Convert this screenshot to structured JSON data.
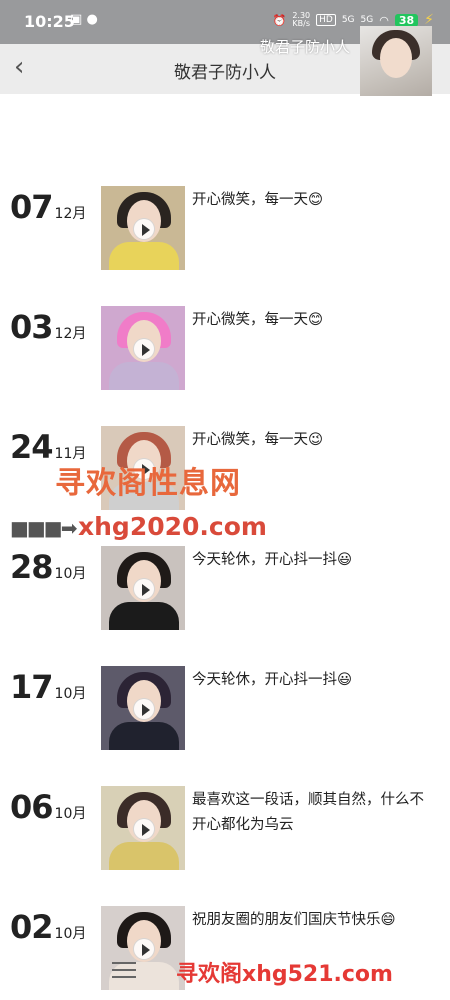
{
  "status_bar": {
    "time": "10:25",
    "left_icons": [
      "notification-icon",
      "wechat-icon"
    ],
    "net_rate": "2.30\nKB/s",
    "hd": "HD",
    "sim1": "5G",
    "sim2": "5G",
    "battery": "38"
  },
  "header": {
    "back_icon": "chevron-left-icon",
    "title": "敬君子防小人"
  },
  "profile": {
    "name": "敬君子防小人"
  },
  "feed": [
    {
      "day": "07",
      "month": "12月",
      "caption": "开心微笑，每一天😊",
      "thumb_colors": {
        "bg": "#c9b895",
        "hair": "#2a2420",
        "body": "#e8d35a"
      }
    },
    {
      "day": "03",
      "month": "12月",
      "caption": "开心微笑，每一天😊",
      "thumb_colors": {
        "bg": "#cfa8cf",
        "hair": "#f07cc8",
        "body": "#c4b2d4"
      }
    },
    {
      "day": "24",
      "month": "11月",
      "caption": "开心微笑，每一天😉",
      "thumb_colors": {
        "bg": "#d9c9b9",
        "hair": "#b45a46",
        "body": "#cfcfcf"
      }
    },
    {
      "day": "28",
      "month": "10月",
      "caption": "今天轮休，开心抖一抖😃",
      "thumb_colors": {
        "bg": "#c9c2be",
        "hair": "#1f1a18",
        "body": "#1b1b1b"
      }
    },
    {
      "day": "17",
      "month": "10月",
      "caption": "今天轮休，开心抖一抖😃",
      "thumb_colors": {
        "bg": "#5d5a6a",
        "hair": "#2c2435",
        "body": "#20222e"
      }
    },
    {
      "day": "06",
      "month": "10月",
      "caption": "最喜欢这一段话，顺其自然，什么不开心都化为乌云",
      "thumb_colors": {
        "bg": "#d8d0b6",
        "hair": "#3b2c28",
        "body": "#d9c46a"
      }
    },
    {
      "day": "02",
      "month": "10月",
      "caption": "祝朋友圈的朋友们国庆节快乐😄",
      "thumb_colors": {
        "bg": "#d6cfcc",
        "hair": "#1e1917",
        "body": "#ece3db"
      }
    }
  ],
  "watermark": {
    "line1": "寻欢阁性息网",
    "line2": "xhg2020.com",
    "bottom": "寻欢阁xhg521.com"
  },
  "bottom_bar": {
    "menu_icon": "hamburger-menu-icon"
  }
}
